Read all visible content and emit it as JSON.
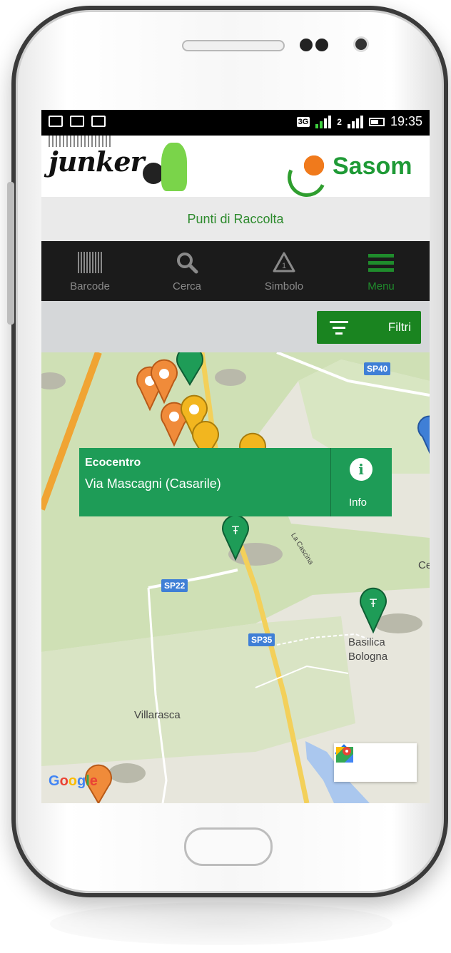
{
  "statusbar": {
    "network": "3G",
    "sim2": "2",
    "time": "19:35"
  },
  "brand": {
    "left_logo": "junker",
    "right_logo": "Sasom"
  },
  "header": {
    "title": "Punti di Raccolta"
  },
  "nav": {
    "items": [
      {
        "label": "Barcode",
        "icon": "barcode-icon"
      },
      {
        "label": "Cerca",
        "icon": "search-icon"
      },
      {
        "label": "Simbolo",
        "icon": "recycle-symbol-icon"
      },
      {
        "label": "Menu",
        "icon": "menu-icon"
      }
    ],
    "active_index": 3
  },
  "filters": {
    "label": "Filtri",
    "icon": "filter-icon"
  },
  "map": {
    "popup": {
      "title": "Ecocentro",
      "address": "Via Mascagni (Casarile)",
      "info_label": "Info"
    },
    "labels": {
      "villarasca": "Villarasca",
      "basilica1": "Basilica",
      "basilica2": "Bologna",
      "cascina": "La Cascina",
      "edge": "Ce"
    },
    "roads": {
      "sp40": "SP40",
      "sp22": "SP22",
      "sp35": "SP35"
    },
    "attribution": "Google",
    "colors": {
      "popup": "#1e9c57",
      "pin_orange": "#f08b3a",
      "pin_yellow": "#f2b61f",
      "pin_green": "#1e9c57",
      "pin_blue": "#3f7fd6"
    }
  }
}
